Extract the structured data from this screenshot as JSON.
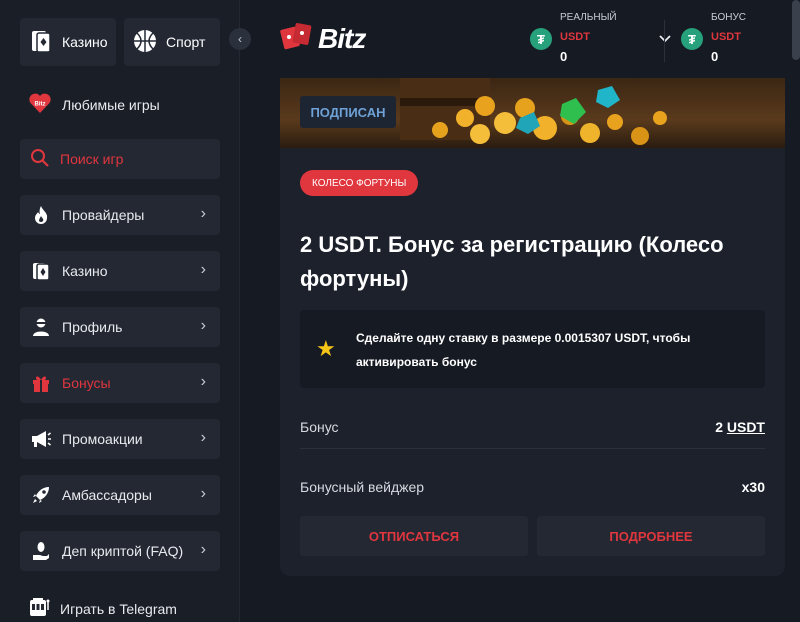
{
  "sidebar": {
    "tabs": [
      {
        "label": "Казино",
        "icon": "cards-icon"
      },
      {
        "label": "Спорт",
        "icon": "basketball-icon"
      }
    ],
    "favorites": {
      "label": "Любимые игры",
      "icon_text": "Bitz"
    },
    "search": {
      "placeholder": "Поиск игр"
    },
    "items": [
      {
        "label": "Провайдеры",
        "icon": "flame-icon"
      },
      {
        "label": "Казино",
        "icon": "cards-icon"
      },
      {
        "label": "Профиль",
        "icon": "user-icon"
      },
      {
        "label": "Бонусы",
        "icon": "gift-icon",
        "active": true
      },
      {
        "label": "Промоакции",
        "icon": "megaphone-icon"
      },
      {
        "label": "Амбассадоры",
        "icon": "rocket-icon"
      },
      {
        "label": "Деп криптой (FAQ)",
        "icon": "hand-coin-icon"
      }
    ],
    "telegram": {
      "label": "Играть в Telegram",
      "icon": "slot-machine-icon"
    }
  },
  "header": {
    "logo": "Bitz",
    "wallets": [
      {
        "label": "РЕАЛЬНЫЙ",
        "currency": "USDT",
        "value": "0"
      },
      {
        "label": "БОНУС",
        "currency": "USDT",
        "value": "0"
      }
    ]
  },
  "bonus": {
    "status": "ПОДПИСАН",
    "tag": "КОЛЕСО ФОРТУНЫ",
    "title": "2 USDT. Бонус за регистрацию (Колесо фортуны)",
    "notice": "Сделайте одну ставку в размере 0.0015307 USDT, чтобы активировать бонус",
    "rows": [
      {
        "label": "Бонус",
        "value_amount": "2",
        "value_currency": "USDT"
      },
      {
        "label": "Бонусный вейджер",
        "value": "x30"
      }
    ],
    "unsubscribe_label": "ОТПИСАТЬСЯ",
    "details_label": "ПОДРОБНЕЕ"
  },
  "colors": {
    "accent": "#e0363e",
    "tether": "#26a17b",
    "star": "#f5c518"
  }
}
